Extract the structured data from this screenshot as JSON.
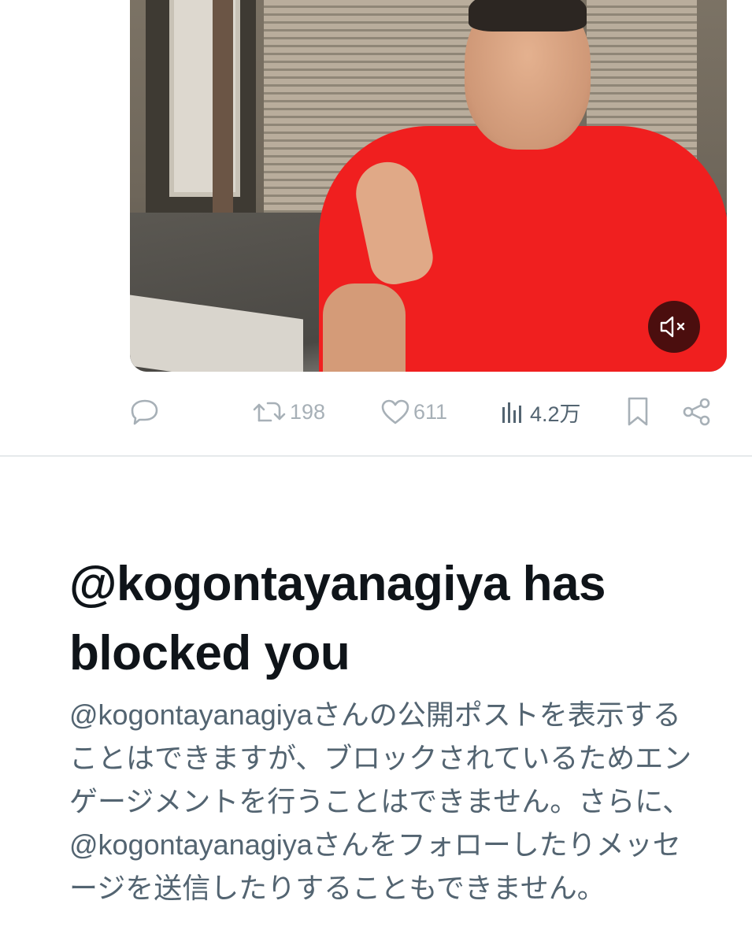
{
  "video": {
    "mute_icon": "speaker-muted-icon"
  },
  "actions": {
    "reply_icon": "comment-icon",
    "retweet_icon": "retweet-icon",
    "retweet_count": "198",
    "like_icon": "heart-icon",
    "like_count": "611",
    "views_icon": "bar-chart-icon",
    "views_count": "4.2万",
    "bookmark_icon": "bookmark-icon",
    "share_icon": "share-icon"
  },
  "blocked": {
    "title": "@kogontayanagiya has blocked you",
    "body": "@kogontayanagiyaさんの公開ポストを表示することはできますが、ブロックされているためエンゲージメントを行うことはできません。さらに、@kogontayanagiyaさんをフォローしたりメッセージを送信したりすることもできません。"
  },
  "colors": {
    "muted_text": "#536471",
    "faint_icon": "#a7b0b7",
    "title_text": "#0f1419",
    "shirt_red": "#f01f1f"
  }
}
